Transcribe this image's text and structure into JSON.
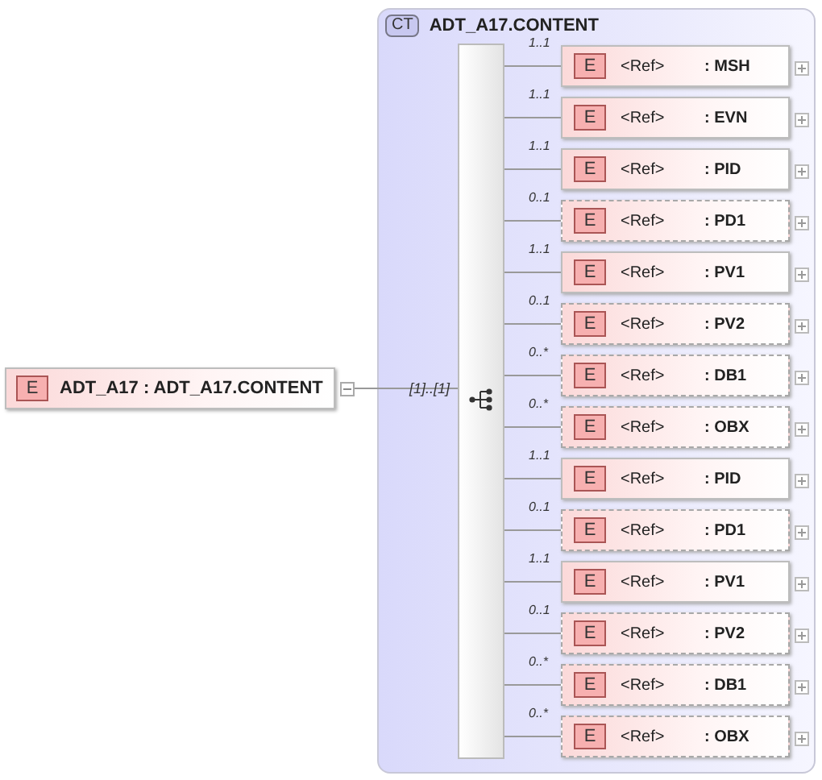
{
  "root": {
    "badge": "E",
    "name": "ADT_A17 : ADT_A17.CONTENT",
    "expanded": true,
    "occurrence": "[1]..[1]"
  },
  "complex_type": {
    "badge": "CT",
    "name": "ADT_A17.CONTENT"
  },
  "elements": [
    {
      "occurrence": "1..1",
      "badge": "E",
      "ref": "<Ref>",
      "name": ": MSH",
      "optional": false
    },
    {
      "occurrence": "1..1",
      "badge": "E",
      "ref": "<Ref>",
      "name": ": EVN",
      "optional": false
    },
    {
      "occurrence": "1..1",
      "badge": "E",
      "ref": "<Ref>",
      "name": ": PID",
      "optional": false
    },
    {
      "occurrence": "0..1",
      "badge": "E",
      "ref": "<Ref>",
      "name": ": PD1",
      "optional": true
    },
    {
      "occurrence": "1..1",
      "badge": "E",
      "ref": "<Ref>",
      "name": ": PV1",
      "optional": false
    },
    {
      "occurrence": "0..1",
      "badge": "E",
      "ref": "<Ref>",
      "name": ": PV2",
      "optional": true
    },
    {
      "occurrence": "0..*",
      "badge": "E",
      "ref": "<Ref>",
      "name": ": DB1",
      "optional": true
    },
    {
      "occurrence": "0..*",
      "badge": "E",
      "ref": "<Ref>",
      "name": ": OBX",
      "optional": true
    },
    {
      "occurrence": "1..1",
      "badge": "E",
      "ref": "<Ref>",
      "name": ": PID",
      "optional": false
    },
    {
      "occurrence": "0..1",
      "badge": "E",
      "ref": "<Ref>",
      "name": ": PD1",
      "optional": true
    },
    {
      "occurrence": "1..1",
      "badge": "E",
      "ref": "<Ref>",
      "name": ": PV1",
      "optional": false
    },
    {
      "occurrence": "0..1",
      "badge": "E",
      "ref": "<Ref>",
      "name": ": PV2",
      "optional": true
    },
    {
      "occurrence": "0..*",
      "badge": "E",
      "ref": "<Ref>",
      "name": ": DB1",
      "optional": true
    },
    {
      "occurrence": "0..*",
      "badge": "E",
      "ref": "<Ref>",
      "name": ": OBX",
      "optional": true
    }
  ]
}
